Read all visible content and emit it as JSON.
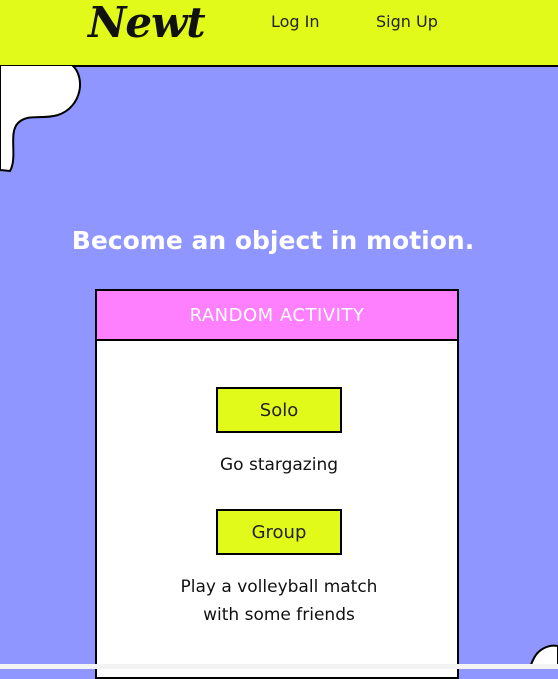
{
  "header": {
    "logo": "Newt",
    "login_label": "Log In",
    "signup_label": "Sign Up"
  },
  "hero": {
    "tagline": "Become an object in motion."
  },
  "card": {
    "title": "RANDOM ACTIVITY",
    "solo": {
      "button_label": "Solo",
      "activity": "Go stargazing"
    },
    "group": {
      "button_label": "Group",
      "activity": "Play a volleyball match with some friends"
    }
  },
  "colors": {
    "background": "#9096ff",
    "header": "#e2fa1a",
    "card_header": "#ff80ff",
    "button": "#e2fa1a"
  }
}
